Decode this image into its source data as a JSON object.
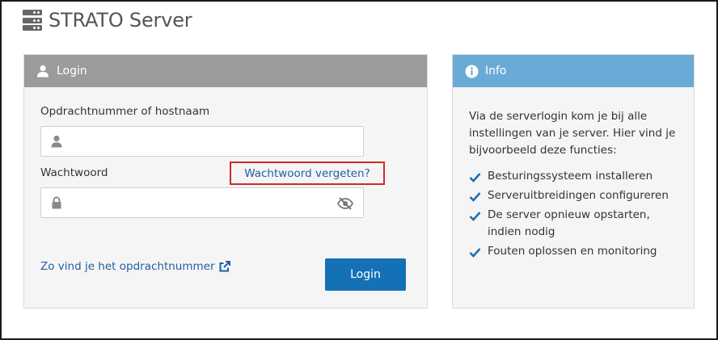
{
  "header": {
    "title": "STRATO Server",
    "icon": "server-icon"
  },
  "login_panel": {
    "heading": "Login",
    "heading_icon": "user-icon",
    "hostname_label": "Opdrachtnummer of hostnaam",
    "hostname_value": "",
    "password_label": "Wachtwoord",
    "password_value": "",
    "forgot_link": "Wachtwoord vergeten?",
    "opdracht_link": "Zo vind je het opdrachtnummer",
    "login_button": "Login"
  },
  "info_panel": {
    "heading": "Info",
    "heading_icon": "info-icon",
    "intro": "Via de serverlogin kom je bij alle instellingen van je server. Hier vind je bijvoorbeeld deze functies:",
    "features": [
      "Besturingssysteem installeren",
      "Serveruitbreidingen configureren",
      "De server opnieuw opstarten, indien nodig",
      "Fouten oplossen en monitoring"
    ]
  },
  "colors": {
    "login_header": "#9b9b9b",
    "info_header": "#6aaad6",
    "primary_button": "#1571b6",
    "link": "#1f5f9f",
    "highlight_border": "#cc2a2a"
  }
}
